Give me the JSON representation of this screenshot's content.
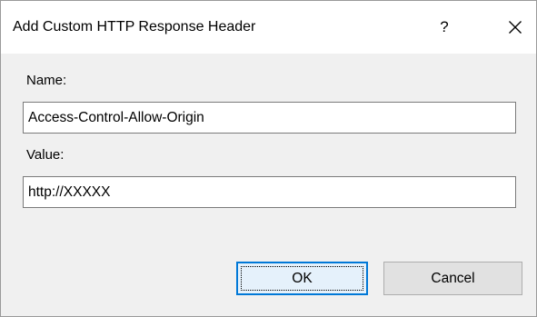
{
  "window": {
    "title": "Add Custom HTTP Response Header",
    "help_label": "?"
  },
  "icons": {
    "close": "close-icon"
  },
  "form": {
    "name_label": "Name:",
    "name_value": "Access-Control-Allow-Origin",
    "value_label": "Value:",
    "value_value": "http://XXXXX"
  },
  "buttons": {
    "ok_label": "OK",
    "cancel_label": "Cancel"
  },
  "colors": {
    "accent": "#0078d7",
    "dialog_background": "#f0f0f0",
    "button_face": "#e1e1e1"
  }
}
